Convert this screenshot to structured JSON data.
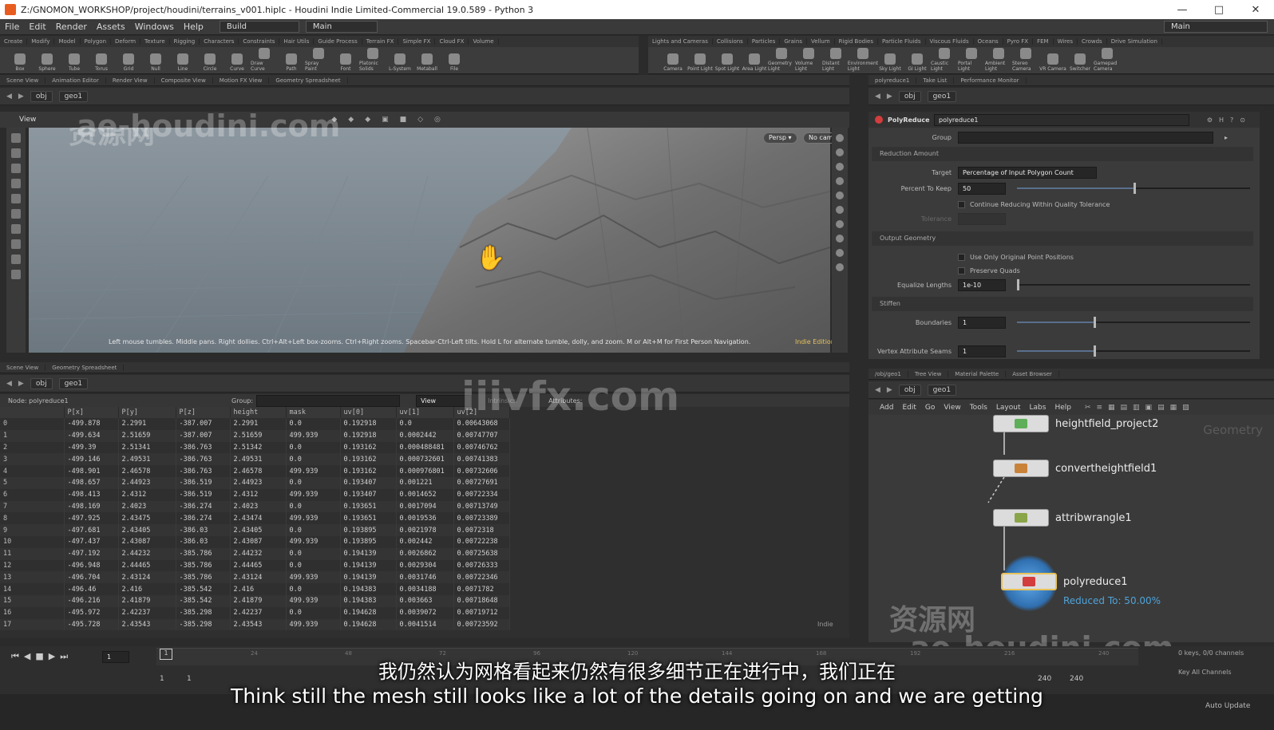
{
  "window": {
    "title": "Z:/GNOMON_WORKSHOP/project/houdini/terrains_v001.hiplc - Houdini Indie Limited-Commercial 19.0.589 - Python 3",
    "minimize": "—",
    "maximize": "□",
    "close": "✕"
  },
  "menu": {
    "items": [
      "File",
      "Edit",
      "Render",
      "Assets",
      "Windows",
      "Help"
    ],
    "desktop": "Build",
    "desktop2": "Main",
    "right_desktop": "Main"
  },
  "shelf_left": {
    "tabs": [
      "Create",
      "Modify",
      "Model",
      "Polygon",
      "Deform",
      "Texture",
      "Rigging",
      "Characters",
      "Constraints",
      "Hair Utils",
      "Guide Process",
      "Terrain FX",
      "Simple FX",
      "Cloud FX",
      "Volume"
    ],
    "tools": [
      "Box",
      "Sphere",
      "Tube",
      "Torus",
      "Grid",
      "Null",
      "Line",
      "Circle",
      "Curve",
      "Draw Curve",
      "Path",
      "Spray Paint",
      "Font",
      "Platonic Solids",
      "L-System",
      "Metaball",
      "File"
    ]
  },
  "shelf_right": {
    "tabs": [
      "Lights and Cameras",
      "Collisions",
      "Particles",
      "Grains",
      "Vellum",
      "Rigid Bodies",
      "Particle Fluids",
      "Viscous Fluids",
      "Oceans",
      "Pyro FX",
      "FEM",
      "Wires",
      "Crowds",
      "Drive Simulation"
    ],
    "tools": [
      "Camera",
      "Point Light",
      "Spot Light",
      "Area Light",
      "Geometry Light",
      "Volume Light",
      "Distant Light",
      "Environment Light",
      "Sky Light",
      "GI Light",
      "Caustic Light",
      "Portal Light",
      "Ambient Light",
      "Stereo Camera",
      "VR Camera",
      "Switcher",
      "Gamepad Camera"
    ]
  },
  "viewer": {
    "tabs": [
      "Scene View",
      "Animation Editor",
      "Render View",
      "Composite View",
      "Motion FX View",
      "Geometry Spreadsheet"
    ],
    "path": [
      "obj",
      "geo1"
    ],
    "label": "View",
    "persp_button": "Persp ▾",
    "cam_button": "No cam ▾",
    "hint": "Left mouse tumbles. Middle pans. Right dollies. Ctrl+Alt+Left box-zooms. Ctrl+Right zooms. Spacebar-Ctrl-Left tilts. Hold L for alternate tumble, dolly, and zoom.    M or Alt+M for First Person Navigation.",
    "edition": "Indie Edition"
  },
  "params": {
    "tabs": [
      "polyreduce1",
      "Take List",
      "Performance Monitor"
    ],
    "path": [
      "obj",
      "geo1"
    ],
    "node_type": "PolyReduce",
    "node_name": "polyreduce1",
    "group_label": "Group",
    "reduction_section": "Reduction Amount",
    "target_label": "Target",
    "target_value": "Percentage of Input Polygon Count",
    "percent_label": "Percent To Keep",
    "percent_value": "50",
    "percent_fraction": 0.5,
    "continue_label": "Continue Reducing Within Quality Tolerance",
    "tolerance_label": "Tolerance",
    "output_section": "Output Geometry",
    "orig_points_label": "Use Only Original Point Positions",
    "quads_label": "Preserve Quads",
    "equalize_label": "Equalize Lengths",
    "equalize_value": "1e-10",
    "stiffen_section": "Stiffen",
    "boundaries_label": "Boundaries",
    "boundaries_value": "1",
    "vertex_label": "Vertex Attribute Seams",
    "vertex_value": "1"
  },
  "spreadsheet": {
    "tabs": [
      "Scene View",
      "Geometry Spreadsheet"
    ],
    "path": [
      "obj",
      "geo1"
    ],
    "node_label": "Node: polyreduce1",
    "group_label": "Group:",
    "view_label": "View",
    "intrinsics_label": "Intrinsics",
    "attributes_label": "Attributes:",
    "footer": "Indie",
    "columns": [
      "",
      "P[x]",
      "P[y]",
      "P[z]",
      "height",
      "mask",
      "uv[0]",
      "uv[1]",
      "uv[2]"
    ],
    "rows": [
      [
        "0",
        "-499.878",
        "2.2991",
        "-387.007",
        "2.2991",
        "0.0",
        "0.192918",
        "0.0",
        "0.00643068"
      ],
      [
        "1",
        "-499.634",
        "2.51659",
        "-387.007",
        "2.51659",
        "499.939",
        "0.192918",
        "0.0002442",
        "0.00747707"
      ],
      [
        "2",
        "-499.39",
        "2.51341",
        "-386.763",
        "2.51342",
        "0.0",
        "0.193162",
        "0.000488481",
        "0.00746762"
      ],
      [
        "3",
        "-499.146",
        "2.49531",
        "-386.763",
        "2.49531",
        "0.0",
        "0.193162",
        "0.000732601",
        "0.00741383"
      ],
      [
        "4",
        "-498.901",
        "2.46578",
        "-386.763",
        "2.46578",
        "499.939",
        "0.193162",
        "0.000976801",
        "0.00732606"
      ],
      [
        "5",
        "-498.657",
        "2.44923",
        "-386.519",
        "2.44923",
        "0.0",
        "0.193407",
        "0.001221",
        "0.00727691"
      ],
      [
        "6",
        "-498.413",
        "2.4312",
        "-386.519",
        "2.4312",
        "499.939",
        "0.193407",
        "0.0014652",
        "0.00722334"
      ],
      [
        "7",
        "-498.169",
        "2.4023",
        "-386.274",
        "2.4023",
        "0.0",
        "0.193651",
        "0.0017094",
        "0.00713749"
      ],
      [
        "8",
        "-497.925",
        "2.43475",
        "-386.274",
        "2.43474",
        "499.939",
        "0.193651",
        "0.0019536",
        "0.00723389"
      ],
      [
        "9",
        "-497.681",
        "2.43405",
        "-386.03",
        "2.43405",
        "0.0",
        "0.193895",
        "0.0021978",
        "0.0072318"
      ],
      [
        "10",
        "-497.437",
        "2.43087",
        "-386.03",
        "2.43087",
        "499.939",
        "0.193895",
        "0.002442",
        "0.00722238"
      ],
      [
        "11",
        "-497.192",
        "2.44232",
        "-385.786",
        "2.44232",
        "0.0",
        "0.194139",
        "0.0026862",
        "0.00725638"
      ],
      [
        "12",
        "-496.948",
        "2.44465",
        "-385.786",
        "2.44465",
        "0.0",
        "0.194139",
        "0.0029304",
        "0.00726333"
      ],
      [
        "13",
        "-496.704",
        "2.43124",
        "-385.786",
        "2.43124",
        "499.939",
        "0.194139",
        "0.0031746",
        "0.00722346"
      ],
      [
        "14",
        "-496.46",
        "2.416",
        "-385.542",
        "2.416",
        "0.0",
        "0.194383",
        "0.0034188",
        "0.0071782"
      ],
      [
        "15",
        "-496.216",
        "2.41879",
        "-385.542",
        "2.41879",
        "499.939",
        "0.194383",
        "0.003663",
        "0.00718648"
      ],
      [
        "16",
        "-495.972",
        "2.42237",
        "-385.298",
        "2.42237",
        "0.0",
        "0.194628",
        "0.0039072",
        "0.00719712"
      ],
      [
        "17",
        "-495.728",
        "2.43543",
        "-385.298",
        "2.43543",
        "499.939",
        "0.194628",
        "0.0041514",
        "0.00723592"
      ]
    ]
  },
  "network": {
    "tabs": [
      "/obj/geo1",
      "Tree View",
      "Material Palette",
      "Asset Browser"
    ],
    "path": [
      "obj",
      "geo1"
    ],
    "menu": [
      "Add",
      "Edit",
      "Go",
      "View",
      "Tools",
      "Layout",
      "Labs",
      "Help"
    ],
    "context_label": "Geometry",
    "nodes": [
      {
        "name": "heightfield_project2",
        "color": "#5fae5a"
      },
      {
        "name": "convertheightfield1",
        "color": "#c9823a"
      },
      {
        "name": "attribwrangle1",
        "color": "#8aa548"
      },
      {
        "name": "polyreduce1",
        "color": "#d23d3d"
      }
    ],
    "status": "Reduced To: 50.00%"
  },
  "timeline": {
    "frame": "1",
    "start": "1",
    "start2": "1",
    "end": "240",
    "end2": "240",
    "keys_label": "0 keys, 0/0 channels",
    "key_all": "Key All Channels",
    "auto_update": "Auto Update",
    "ticks": [
      "24",
      "48",
      "72",
      "96",
      "120",
      "144",
      "168",
      "192",
      "216",
      "240"
    ]
  },
  "subtitles": {
    "cn": "我仍然认为网格看起来仍然有很多细节正在进行中，我们正在",
    "en": "Think still the mesh still looks like a lot of the details going on and we are getting"
  },
  "watermarks": {
    "a": "资源网",
    "b": "ae-houdini.com",
    "c": "iiivfx.com",
    "d": "资源网",
    "e": "ae-houdini.com"
  },
  "colors": {
    "accent": "#e85d1f",
    "status_blue": "#4fa3d8",
    "edition": "#e8c25a"
  }
}
